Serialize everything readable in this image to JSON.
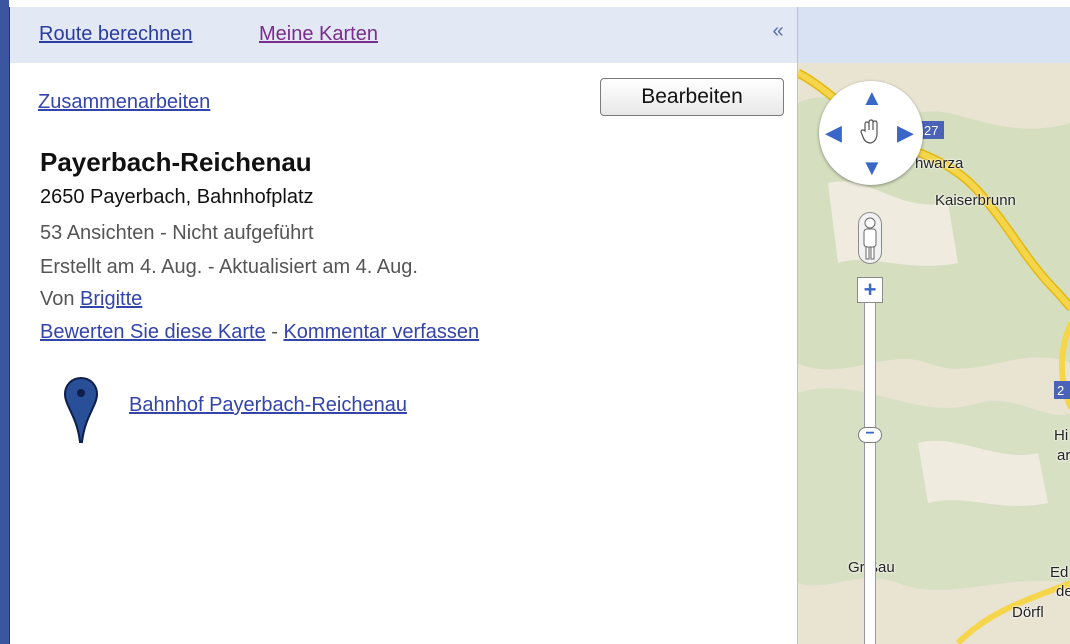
{
  "tabs": {
    "route": "Route berechnen",
    "my_maps": "Meine Karten",
    "collapse_glyph": "«"
  },
  "map_info": {
    "collaborate": "Zusammenarbeiten",
    "edit_button": "Bearbeiten",
    "title": "Payerbach-Reichenau",
    "address": "2650 Payerbach, Bahnhofplatz",
    "views": "53 Ansichten - Nicht aufgeführt",
    "created": "Erstellt am 4. Aug. - Aktualisiert am 4. Aug.",
    "author_prefix": "Von ",
    "author": "Brigitte",
    "rate_link": "Bewerten Sie diese Karte",
    "separator": " - ",
    "comment_link": "Kommentar verfassen"
  },
  "places": [
    {
      "label": "Bahnhof Payerbach-Reichenau",
      "icon": "map-pin-icon",
      "color": "#2a4f99"
    }
  ],
  "map": {
    "labels": {
      "schwarza": "hwarza",
      "kaiserbrunn": "Kaiserbrunn",
      "hi": "Hi",
      "ar": "ar",
      "griessau": "Gr  ßau",
      "ed": "Ed",
      "de": "de",
      "doerfl": "Dörfl"
    },
    "shields": {
      "road_27": "27",
      "road_2": "2"
    },
    "zoom_plus": "+",
    "zoom_minus": "−"
  },
  "colors": {
    "left_accent": "#3b55a0",
    "tab_bar": "#e3e8f5",
    "link": "#3344aa",
    "visited_link": "#7a2d8c",
    "map_road": "#f5d64a",
    "map_land": "#e9e3d2",
    "map_forest": "#c9d8b4"
  }
}
